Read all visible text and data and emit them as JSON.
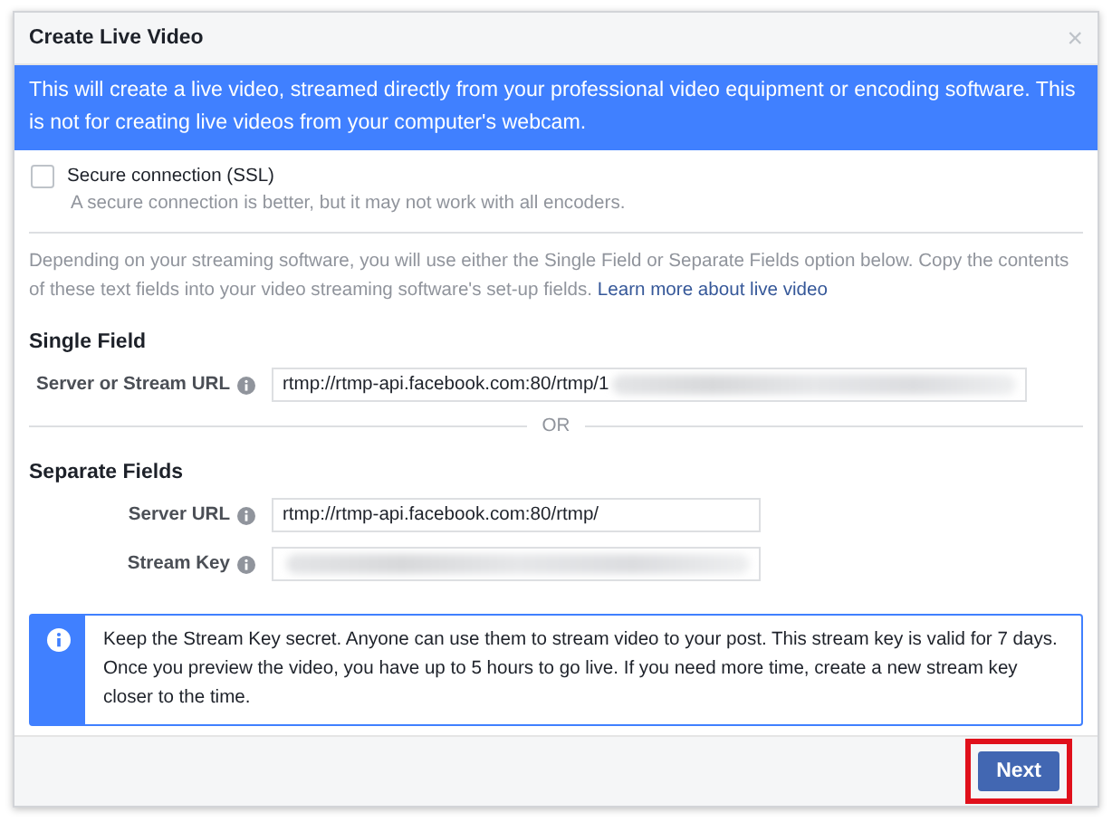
{
  "dialog": {
    "title": "Create Live Video",
    "close": "×"
  },
  "banner": "This will create a live video, streamed directly from your professional video equipment or encoding software. This is not for creating live videos from your computer's webcam.",
  "secure": {
    "label": "Secure connection (SSL)",
    "checked": false,
    "hint": "A secure connection is better, but it may not work with all encoders."
  },
  "intro": {
    "text": "Depending on your streaming software, you will use either the Single Field or Separate Fields option below. Copy the contents of these text fields into your video streaming software's set-up fields.",
    "link": "Learn more about live video"
  },
  "single": {
    "heading": "Single Field",
    "fields": [
      {
        "label": "Server or Stream URL",
        "value": "rtmp://rtmp-api.facebook.com:80/rtmp/1",
        "redacted": true
      }
    ]
  },
  "divider": "OR",
  "separate": {
    "heading": "Separate Fields",
    "fields": [
      {
        "label": "Server URL",
        "value": "rtmp://rtmp-api.facebook.com:80/rtmp/",
        "redacted": false
      },
      {
        "label": "Stream Key",
        "redacted": true
      }
    ]
  },
  "notice": "Keep the Stream Key secret. Anyone can use them to stream video to your post. This stream key is valid for 7 days. Once you preview the video, you have up to 5 hours to go live. If you need more time, create a new stream key closer to the time.",
  "footer": {
    "button": "Next",
    "highlighted": true
  }
}
